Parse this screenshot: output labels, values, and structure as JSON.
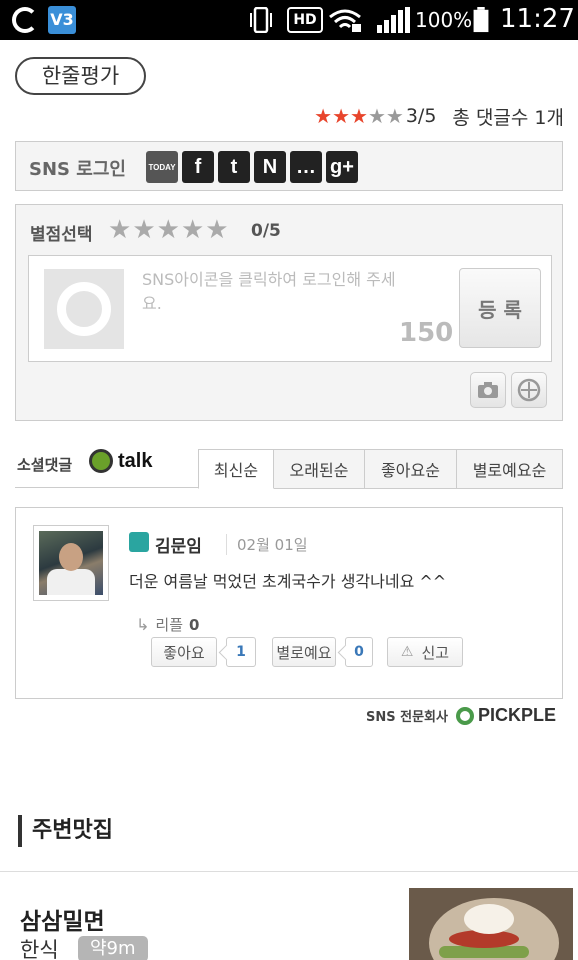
{
  "status_bar": {
    "battery": "100%",
    "time": "11:27",
    "hd_label": "HD",
    "app2_label": "V3"
  },
  "review": {
    "title": "한줄평가",
    "score": "3/5",
    "total_comments": "총 댓글수 1개",
    "stars_on": 3,
    "stars_total": 5
  },
  "sns_login": {
    "label": "SNS 로그인",
    "providers": [
      "todays",
      "facebook-icon",
      "twitter-icon",
      "naver-icon",
      "talk-icon",
      "googleplus-icon"
    ],
    "provider_glyphs": [
      "TODAY",
      "f",
      "t",
      "N",
      "…",
      "g+"
    ]
  },
  "rating_input": {
    "label": "별점선택",
    "score": "0/5",
    "placeholder": "SNS아이콘을 클릭하여 로그인해 주세요.",
    "char_limit": "150",
    "submit_label": "등 록"
  },
  "social": {
    "label": "소셜댓글",
    "brand": "talk",
    "tabs": [
      "최신순",
      "오래된순",
      "좋아요순",
      "별로예요순"
    ]
  },
  "comment": {
    "user": "김문임",
    "date": "02월 01일",
    "text": "더운 여름날 먹었던 초계국수가 생각나네요 ^^",
    "reply_label": "리플",
    "reply_count": "0",
    "like_label": "좋아요",
    "like_count": "1",
    "dislike_label": "별로예요",
    "dislike_count": "0",
    "report_label": "신고"
  },
  "sns_company": {
    "label": "SNS 전문회사",
    "brand": "PICKPLE"
  },
  "nearby": {
    "title": "주변맛집",
    "restaurants": [
      {
        "name": "삼삼밀면",
        "category": "한식",
        "distance": "약9m"
      }
    ]
  },
  "colors": {
    "star_on": "#e8452c",
    "star_off": "#9a9a9a",
    "count_blue": "#3a78b8",
    "talk_green": "#6aa02a"
  }
}
